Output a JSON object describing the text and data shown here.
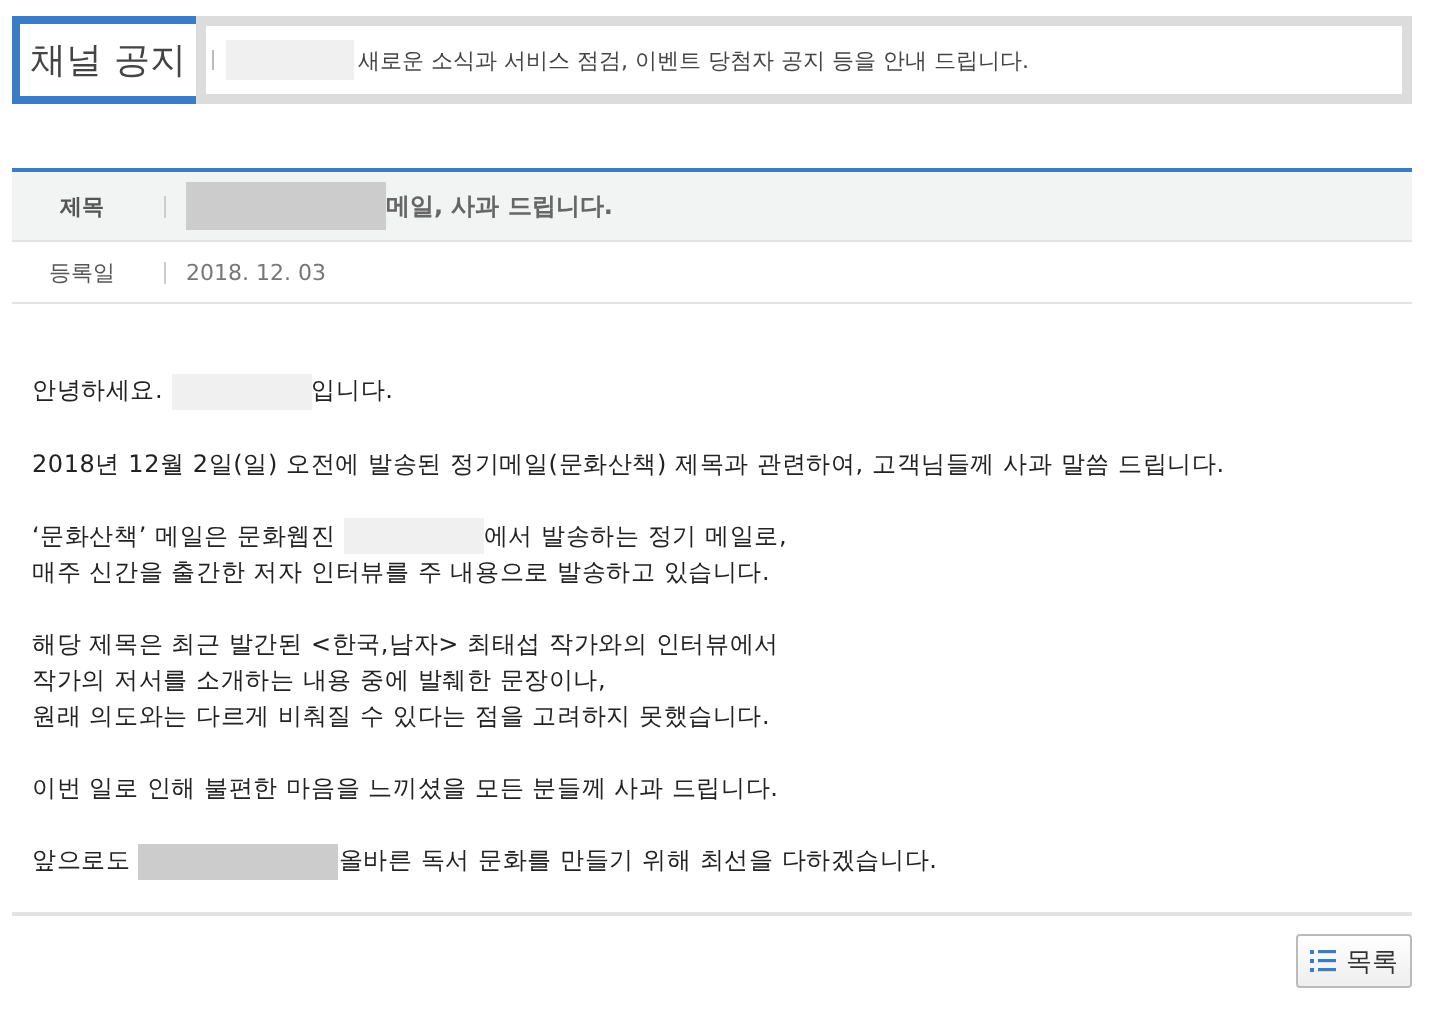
{
  "header": {
    "title": "채널 공지",
    "description": [
      {
        "kind": "redacted",
        "color": "#f0f0f0"
      },
      {
        "kind": "text",
        "text": "새로운 소식과 서비스 점검, 이벤트 당첨자 공지 등을 안내 드립니다."
      }
    ]
  },
  "post": {
    "subject_label": "제목",
    "subject": [
      {
        "kind": "redacted",
        "color": "#cccccc"
      },
      {
        "kind": "text",
        "text": "메일, 사과 드립니다."
      }
    ],
    "date_label": "등록일",
    "date": "2018. 12. 03",
    "paragraphs": [
      [
        [
          {
            "kind": "text",
            "text": "안녕하세요. "
          },
          {
            "kind": "redacted",
            "color": "#f0f0f0"
          },
          {
            "kind": "text",
            "text": "입니다."
          }
        ]
      ],
      [
        [
          {
            "kind": "text",
            "text": "2018년 12월 2일(일) 오전에 발송된 정기메일(문화산책) 제목과 관련하여, 고객님들께 사과 말씀 드립니다."
          }
        ]
      ],
      [
        [
          {
            "kind": "text",
            "text": "‘문화산책’ 메일은 문화웹진 "
          },
          {
            "kind": "redacted",
            "color": "#f0f0f0"
          },
          {
            "kind": "text",
            "text": "에서 발송하는 정기 메일로,"
          }
        ],
        [
          {
            "kind": "text",
            "text": "매주 신간을 출간한 저자 인터뷰를 주 내용으로 발송하고 있습니다."
          }
        ]
      ],
      [
        [
          {
            "kind": "text",
            "text": "해당 제목은 최근 발간된 <한국,남자> 최태섭 작가와의 인터뷰에서"
          }
        ],
        [
          {
            "kind": "text",
            "text": "작가의 저서를 소개하는 내용 중에 발췌한 문장이나,"
          }
        ],
        [
          {
            "kind": "text",
            "text": "원래 의도와는 다르게 비춰질 수 있다는 점을 고려하지 못했습니다."
          }
        ]
      ],
      [
        [
          {
            "kind": "text",
            "text": "이번 일로 인해 불편한 마음을 느끼셨을 모든 분들께 사과 드립니다."
          }
        ]
      ],
      [
        [
          {
            "kind": "text",
            "text": "앞으로도 "
          },
          {
            "kind": "redacted",
            "color": "#cccccc"
          },
          {
            "kind": "text",
            "text": "올바른 독서 문화를 만들기 위해 최선을 다하겠습니다."
          }
        ]
      ]
    ]
  },
  "list_button": {
    "label": "목록"
  }
}
